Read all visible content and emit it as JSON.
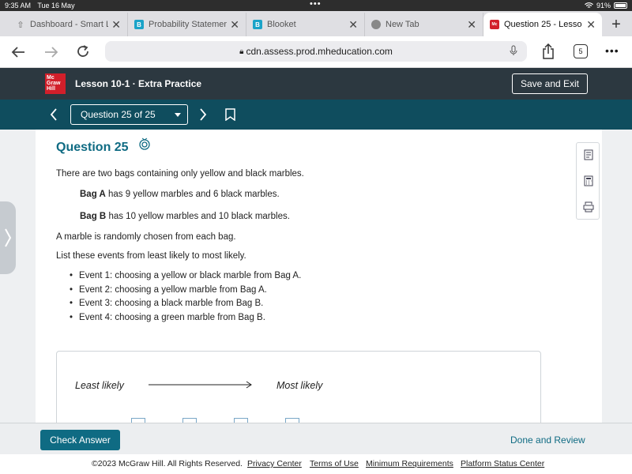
{
  "status_bar": {
    "time": "9:35 AM",
    "date": "Tue 16 May",
    "battery": "91%"
  },
  "tabs": [
    {
      "label": "Dashboard - Smart L",
      "icon": "upload-icon"
    },
    {
      "label": "Probability Statemer",
      "icon": "blooket-icon"
    },
    {
      "label": "Blooket",
      "icon": "blooket-icon"
    },
    {
      "label": "New Tab",
      "icon": "globe-icon"
    },
    {
      "label": "Question 25 - Lesso",
      "icon": "mcgraw-hill-icon",
      "active": true
    }
  ],
  "address_bar": {
    "url": "cdn.assess.prod.mheducation.com",
    "tab_count": "5"
  },
  "header": {
    "logo_lines": [
      "Mc",
      "Graw",
      "Hill"
    ],
    "lesson_title": "Lesson 10-1 · Extra Practice",
    "save_exit_label": "Save and Exit"
  },
  "question_nav": {
    "selector_label": "Question 25 of 25"
  },
  "question": {
    "title": "Question 25",
    "intro": "There are two bags containing only yellow and black marbles.",
    "bag_a_label": "Bag A",
    "bag_a_text": "has 9 yellow marbles and 6 black marbles.",
    "bag_b_label": "Bag B",
    "bag_b_text": "has 10 yellow marbles and 10 black marbles.",
    "chosen": "A marble is randomly chosen from each bag.",
    "instruction": "List these events from least likely to most likely.",
    "events": [
      "Event 1: choosing a yellow or black marble from Bag A.",
      "Event 2: choosing a yellow marble from Bag A.",
      "Event 3: choosing a black marble from Bag B.",
      "Event 4: choosing a green marble from Bag B."
    ]
  },
  "answer_area": {
    "least_label": "Least likely",
    "most_label": "Most likely"
  },
  "bottom_bar": {
    "check_label": "Check Answer",
    "done_label": "Done and Review"
  },
  "footer": {
    "copyright": "©2023 McGraw Hill. All Rights Reserved.",
    "links": [
      "Privacy Center",
      "Terms of Use",
      "Minimum Requirements",
      "Platform Status Center"
    ]
  },
  "colors": {
    "teal": "#0f6b83",
    "nav_bg": "#0f4d5e",
    "header_bg": "#2c3840",
    "brand_red": "#d21f2a"
  }
}
